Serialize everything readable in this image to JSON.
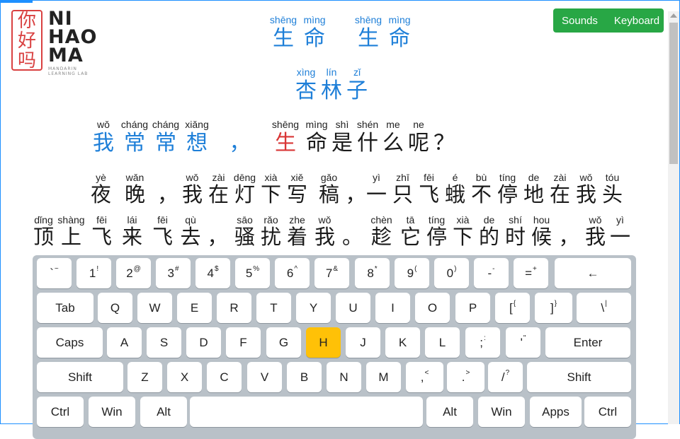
{
  "logo": {
    "seal_chars": [
      "你",
      "好",
      "吗"
    ],
    "brand_lines": [
      "NI",
      "HAO",
      "MA"
    ],
    "tagline": [
      "MANDARIN",
      "LEARNING LAB"
    ]
  },
  "top_buttons": {
    "sounds": "Sounds",
    "keyboard": "Keyboard",
    "color": "#28a745"
  },
  "text": {
    "title": [
      {
        "py": "shēng",
        "hz": "生"
      },
      {
        "py": "mìng",
        "hz": "命"
      },
      {
        "py": "",
        "hz": ""
      },
      {
        "py": "shēng",
        "hz": "生"
      },
      {
        "py": "mìng",
        "hz": "命"
      }
    ],
    "author": [
      {
        "py": "xìng",
        "hz": "杏"
      },
      {
        "py": "lín",
        "hz": "林"
      },
      {
        "py": "zǐ",
        "hz": "子"
      }
    ],
    "line1": [
      {
        "py": "wǒ",
        "hz": "我"
      },
      {
        "py": "cháng",
        "hz": "常"
      },
      {
        "py": "cháng",
        "hz": "常"
      },
      {
        "py": "xiǎng",
        "hz": "想"
      },
      {
        "py": "",
        "hz": "，"
      },
      {
        "py": "shēng",
        "hz": "生"
      },
      {
        "py": "mìng",
        "hz": "命"
      },
      {
        "py": "shì",
        "hz": "是"
      },
      {
        "py": "shén",
        "hz": "什"
      },
      {
        "py": "me",
        "hz": "么"
      },
      {
        "py": "ne",
        "hz": "呢"
      },
      {
        "py": "",
        "hz": "？"
      }
    ],
    "line2": [
      {
        "py": "yè",
        "hz": "夜"
      },
      {
        "py": "wǎn",
        "hz": "晚"
      },
      {
        "py": "",
        "hz": "，"
      },
      {
        "py": "wǒ",
        "hz": "我"
      },
      {
        "py": "zài",
        "hz": "在"
      },
      {
        "py": "dēng",
        "hz": "灯"
      },
      {
        "py": "xià",
        "hz": "下"
      },
      {
        "py": "xiě",
        "hz": "写"
      },
      {
        "py": "gǎo",
        "hz": "稿"
      },
      {
        "py": "",
        "hz": "，"
      },
      {
        "py": "yì",
        "hz": "一"
      },
      {
        "py": "zhī",
        "hz": "只"
      },
      {
        "py": "fēi",
        "hz": "飞"
      },
      {
        "py": "é",
        "hz": "蛾"
      },
      {
        "py": "bù",
        "hz": "不"
      },
      {
        "py": "tíng",
        "hz": "停"
      },
      {
        "py": "de",
        "hz": "地"
      },
      {
        "py": "zài",
        "hz": "在"
      },
      {
        "py": "wǒ",
        "hz": "我"
      },
      {
        "py": "tóu",
        "hz": "头"
      }
    ],
    "line3": [
      {
        "py": "dǐng",
        "hz": "顶"
      },
      {
        "py": "shàng",
        "hz": "上"
      },
      {
        "py": "fēi",
        "hz": "飞"
      },
      {
        "py": "lái",
        "hz": "来"
      },
      {
        "py": "fēi",
        "hz": "飞"
      },
      {
        "py": "qù",
        "hz": "去"
      },
      {
        "py": "",
        "hz": "，"
      },
      {
        "py": "sāo",
        "hz": "骚"
      },
      {
        "py": "rǎo",
        "hz": "扰"
      },
      {
        "py": "zhe",
        "hz": "着"
      },
      {
        "py": "wǒ",
        "hz": "我"
      },
      {
        "py": "",
        "hz": "。"
      },
      {
        "py": "chèn",
        "hz": "趁"
      },
      {
        "py": "tā",
        "hz": "它"
      },
      {
        "py": "tíng",
        "hz": "停"
      },
      {
        "py": "xià",
        "hz": "下"
      },
      {
        "py": "de",
        "hz": "的"
      },
      {
        "py": "shí",
        "hz": "时"
      },
      {
        "py": "hou",
        "hz": "候"
      },
      {
        "py": "",
        "hz": "，"
      },
      {
        "py": "wǒ",
        "hz": "我"
      },
      {
        "py": "yì",
        "hz": "一"
      }
    ]
  },
  "highlight_color": "#d93636",
  "typed_color": "#1e7fd8",
  "keyboard": {
    "active_key": "H",
    "active_color": "#ffc107",
    "rows": [
      [
        {
          "l": "`",
          "s": "~"
        },
        {
          "l": "1",
          "s": "!"
        },
        {
          "l": "2",
          "s": "@"
        },
        {
          "l": "3",
          "s": "#"
        },
        {
          "l": "4",
          "s": "$"
        },
        {
          "l": "5",
          "s": "%"
        },
        {
          "l": "6",
          "s": "^"
        },
        {
          "l": "7",
          "s": "&"
        },
        {
          "l": "8",
          "s": "*"
        },
        {
          "l": "9",
          "s": "("
        },
        {
          "l": "0",
          "s": ")"
        },
        {
          "l": "-",
          "s": "-"
        },
        {
          "l": "=",
          "s": "+"
        },
        {
          "l": "←",
          "s": ""
        }
      ],
      [
        {
          "l": "Tab",
          "s": ""
        },
        {
          "l": "Q",
          "s": ""
        },
        {
          "l": "W",
          "s": ""
        },
        {
          "l": "E",
          "s": ""
        },
        {
          "l": "R",
          "s": ""
        },
        {
          "l": "T",
          "s": ""
        },
        {
          "l": "Y",
          "s": ""
        },
        {
          "l": "U",
          "s": ""
        },
        {
          "l": "I",
          "s": ""
        },
        {
          "l": "O",
          "s": ""
        },
        {
          "l": "P",
          "s": ""
        },
        {
          "l": "[",
          "s": "{"
        },
        {
          "l": "]",
          "s": "}"
        },
        {
          "l": "\\",
          "s": "|"
        }
      ],
      [
        {
          "l": "Caps",
          "s": ""
        },
        {
          "l": "A",
          "s": ""
        },
        {
          "l": "S",
          "s": ""
        },
        {
          "l": "D",
          "s": ""
        },
        {
          "l": "F",
          "s": ""
        },
        {
          "l": "G",
          "s": ""
        },
        {
          "l": "H",
          "s": ""
        },
        {
          "l": "J",
          "s": ""
        },
        {
          "l": "K",
          "s": ""
        },
        {
          "l": "L",
          "s": ""
        },
        {
          "l": ";",
          "s": ":"
        },
        {
          "l": "'",
          "s": "\""
        },
        {
          "l": "Enter",
          "s": ""
        }
      ],
      [
        {
          "l": "Shift",
          "s": ""
        },
        {
          "l": "Z",
          "s": ""
        },
        {
          "l": "X",
          "s": ""
        },
        {
          "l": "C",
          "s": ""
        },
        {
          "l": "V",
          "s": ""
        },
        {
          "l": "B",
          "s": ""
        },
        {
          "l": "N",
          "s": ""
        },
        {
          "l": "M",
          "s": ""
        },
        {
          "l": ",",
          "s": "<"
        },
        {
          "l": ".",
          "s": ">"
        },
        {
          "l": "/",
          "s": "?"
        },
        {
          "l": "Shift",
          "s": ""
        }
      ],
      [
        {
          "l": "Ctrl",
          "s": ""
        },
        {
          "l": "Win",
          "s": ""
        },
        {
          "l": "Alt",
          "s": ""
        },
        {
          "l": "",
          "s": ""
        },
        {
          "l": "Alt",
          "s": ""
        },
        {
          "l": "Win",
          "s": ""
        },
        {
          "l": "Apps",
          "s": ""
        },
        {
          "l": "Ctrl",
          "s": ""
        }
      ]
    ]
  }
}
